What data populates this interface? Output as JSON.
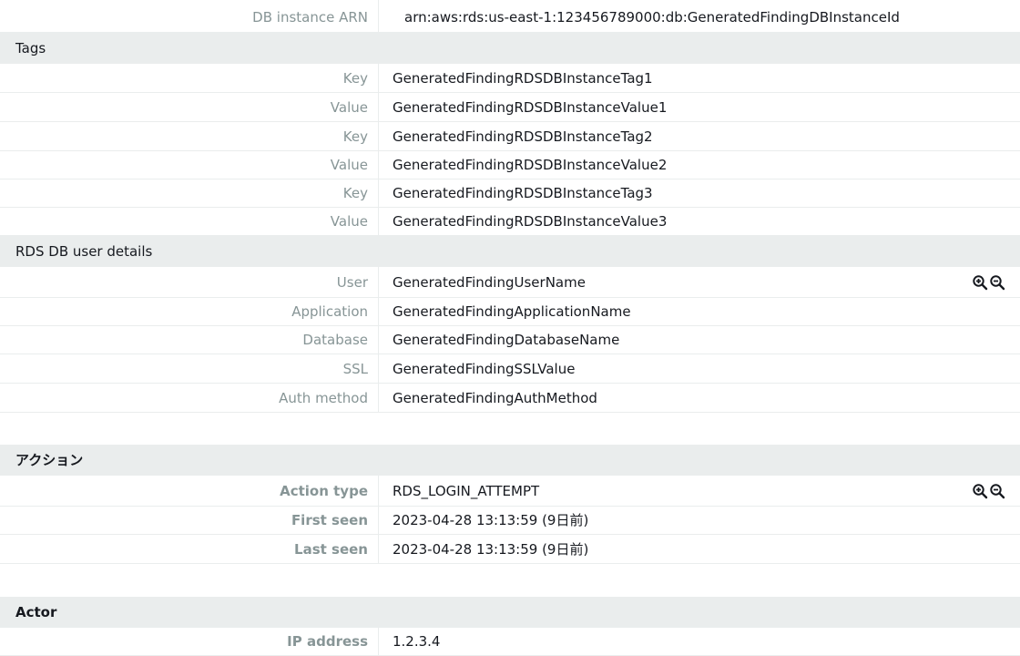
{
  "instance": {
    "arn_label": "DB instance ARN",
    "arn_value": "arn:aws:rds:us-east-1:123456789000:db:GeneratedFindingDBInstanceId"
  },
  "tags": {
    "title": "Tags",
    "rows": [
      {
        "label": "Key",
        "value": "GeneratedFindingRDSDBInstanceTag1"
      },
      {
        "label": "Value",
        "value": "GeneratedFindingRDSDBInstanceValue1"
      },
      {
        "label": "Key",
        "value": "GeneratedFindingRDSDBInstanceTag2"
      },
      {
        "label": "Value",
        "value": "GeneratedFindingRDSDBInstanceValue2"
      },
      {
        "label": "Key",
        "value": "GeneratedFindingRDSDBInstanceTag3"
      },
      {
        "label": "Value",
        "value": "GeneratedFindingRDSDBInstanceValue3"
      }
    ]
  },
  "user_details": {
    "title": "RDS DB user details",
    "rows": [
      {
        "label": "User",
        "value": "GeneratedFindingUserName"
      },
      {
        "label": "Application",
        "value": "GeneratedFindingApplicationName"
      },
      {
        "label": "Database",
        "value": "GeneratedFindingDatabaseName"
      },
      {
        "label": "SSL",
        "value": "GeneratedFindingSSLValue"
      },
      {
        "label": "Auth method",
        "value": "GeneratedFindingAuthMethod"
      }
    ]
  },
  "action": {
    "title": "アクション",
    "rows": [
      {
        "label": "Action type",
        "value": "RDS_LOGIN_ATTEMPT"
      },
      {
        "label": "First seen",
        "value": "2023-04-28 13:13:59 (9日前)"
      },
      {
        "label": "Last seen",
        "value": "2023-04-28 13:13:59 (9日前)"
      }
    ]
  },
  "actor": {
    "title": "Actor",
    "rows": [
      {
        "label": "IP address",
        "value": "1.2.3.4"
      }
    ]
  },
  "icons": {
    "zoom_in": "zoom-in-icon",
    "zoom_out": "zoom-out-icon"
  },
  "colors": {
    "section_bg": "#eaeded",
    "label_text": "#879596",
    "value_text": "#16191f",
    "divider": "#eaeded"
  }
}
